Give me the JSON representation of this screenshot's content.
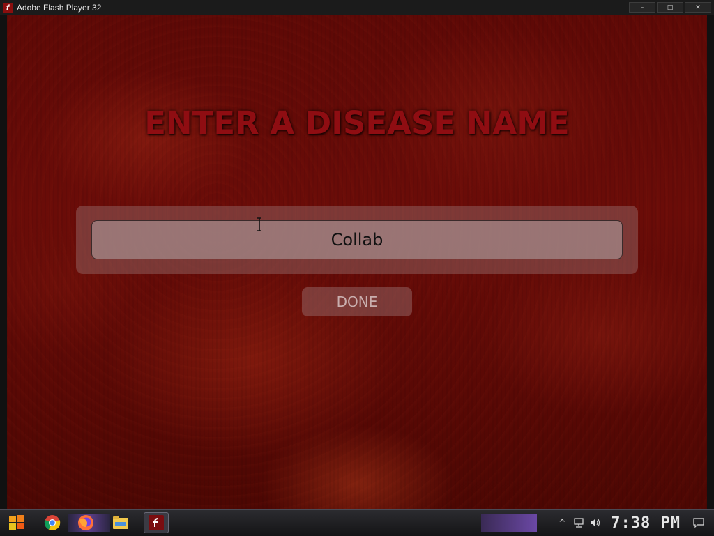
{
  "window": {
    "title": "Adobe Flash Player 32",
    "minimize_label": "–",
    "maximize_label": "□",
    "close_label": "✕"
  },
  "game": {
    "heading": "ENTER A DISEASE NAME",
    "input_value": "Collab",
    "done_label": "DONE"
  },
  "taskbar": {
    "apps": [
      "start-icon",
      "chrome-icon",
      "firefox-icon",
      "file-explorer-icon",
      "flash-player-icon"
    ],
    "clock": "7:38 PM",
    "tray_chevron": "^"
  },
  "colors": {
    "heading": "#8f0d12",
    "background": "#5e0906"
  }
}
